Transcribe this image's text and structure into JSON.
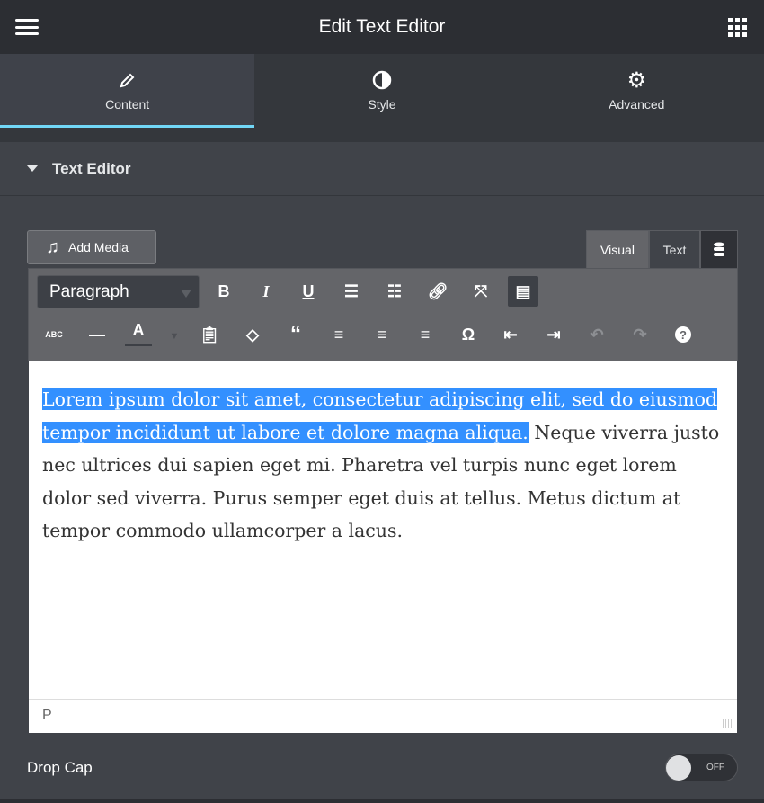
{
  "header": {
    "title": "Edit Text Editor"
  },
  "tabs": [
    {
      "label": "Content"
    },
    {
      "label": "Style"
    },
    {
      "label": "Advanced"
    }
  ],
  "section": {
    "title": "Text Editor"
  },
  "editor": {
    "add_media": "Add Media",
    "mode_tabs": {
      "visual": "Visual",
      "text": "Text"
    },
    "format_select": "Paragraph",
    "content_selected": "Lorem ipsum dolor sit amet, consectetur adipiscing elit, sed do eiusmod tempor incididunt ut labore et dolore magna aliqua.",
    "content_rest": " Neque viverra justo nec ultrices dui sapien eget mi. Pharetra vel turpis nunc eget lorem dolor sed viverra. Purus semper eget duis at tellus. Metus dictum at tempor commodo ullamcorper a lacus.",
    "status_path": "P"
  },
  "drop_cap": {
    "label": "Drop Cap",
    "toggle_label": "OFF",
    "enabled": false
  },
  "colors": {
    "accent": "#71d7f7",
    "selection": "#3390ff"
  }
}
